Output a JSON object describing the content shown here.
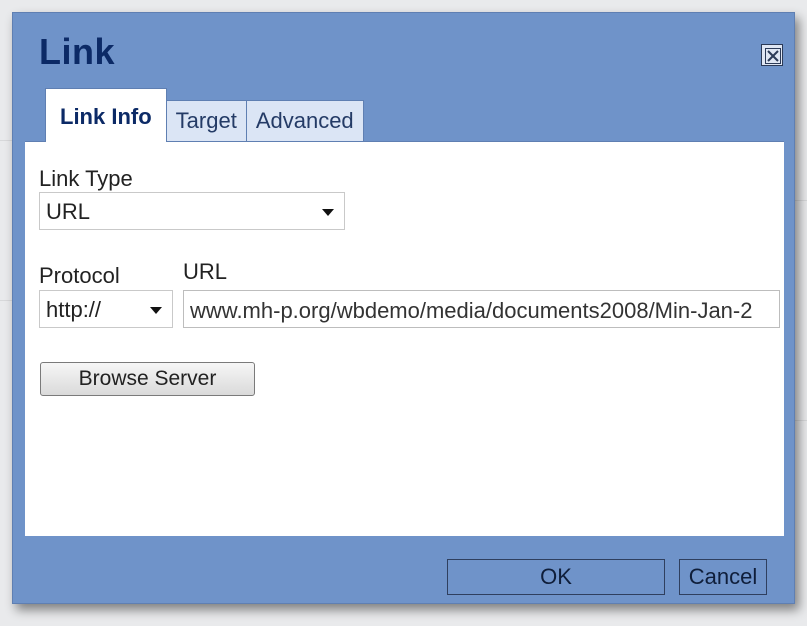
{
  "dialog": {
    "title": "Link",
    "close_icon": "close-icon"
  },
  "tabs": [
    {
      "label": "Link Info",
      "active": true
    },
    {
      "label": "Target",
      "active": false
    },
    {
      "label": "Advanced",
      "active": false
    }
  ],
  "link_info": {
    "link_type_label": "Link Type",
    "link_type_value": "URL",
    "protocol_label": "Protocol",
    "protocol_value": "http://",
    "url_label": "URL",
    "url_value": "www.mh-p.org/wbdemo/media/documents2008/Min-Jan-2",
    "browse_button": "Browse Server"
  },
  "footer": {
    "ok_label": "OK",
    "cancel_label": "Cancel"
  },
  "colors": {
    "dialog_blue": "#6f93c9",
    "title_navy": "#0c2a66"
  }
}
